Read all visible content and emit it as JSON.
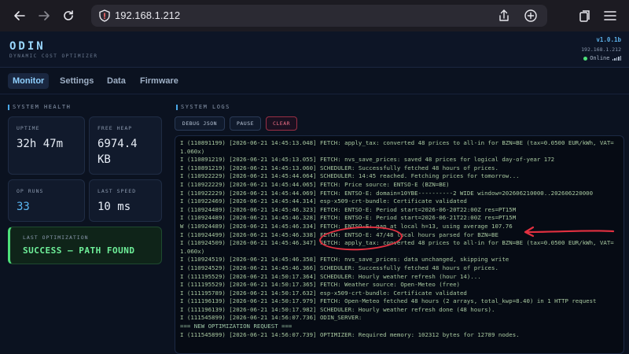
{
  "browser": {
    "url": "192.168.1.212"
  },
  "header": {
    "brand": "ODIN",
    "subtitle": "DYNAMIC COST OPTIMIZER",
    "version": "v1.0.1b",
    "host": "192.168.1.212",
    "status": "Online"
  },
  "tabs": [
    {
      "label": "Monitor"
    },
    {
      "label": "Settings"
    },
    {
      "label": "Data"
    },
    {
      "label": "Firmware"
    }
  ],
  "system_health": {
    "title": "SYSTEM HEALTH",
    "uptime_label": "UPTIME",
    "uptime_value": "32h 47m",
    "heap_label": "FREE HEAP",
    "heap_value": "6974.4 KB",
    "runs_label": "OP RUNS",
    "runs_value": "33",
    "speed_label": "LAST SPEED",
    "speed_value": "10 ms",
    "last_opt_label": "LAST OPTIMIZATION",
    "last_opt_value": "SUCCESS — PATH FOUND"
  },
  "logs": {
    "title": "SYSTEM LOGS",
    "debug_label": "DEBUG JSON",
    "pause_label": "PAUSE",
    "clear_label": "CLEAR",
    "lines": [
      "I (110891199) [2026-06-21 14:45:13.048] FETCH: apply_tax: converted 48 prices to all-in for BZN=BE (tax=0.0500 EUR/kWh, VAT=",
      "1.060x)",
      "I (110891219) [2026-06-21 14:45:13.055] FETCH: nvs_save_prices: saved 48 prices for logical day-of-year 172",
      "I (110891219) [2026-06-21 14:45:13.060] SCHEDULER: Successfully fetched 48 hours of prices.",
      "I (110922229) [2026-06-21 14:45:44.064] SCHEDULER: 14:45 reached. Fetching prices for tomorrow...",
      "I (110922229) [2026-06-21 14:45:44.065] FETCH: Price source: ENTSO-E (BZN=BE)",
      "I (110922229) [2026-06-21 14:45:44.069] FETCH: ENTSO-E: domain=10YBE----------2 WIDE window=202606210000..202606220000",
      "I (110922469) [2026-06-21 14:45:44.314] esp-x509-crt-bundle: Certificate validated",
      "I (110924489) [2026-06-21 14:45:46.323] FETCH: ENTSO-E: Period start=2026-06-20T22:00Z res=PT15M",
      "I (110924489) [2026-06-21 14:45:46.328] FETCH: ENTSO-E: Period start=2026-06-21T22:00Z res=PT15M",
      "W (110924489) [2026-06-21 14:45:46.334] FETCH: ENTSO-E: gap at local h=13, using average 107.76",
      "I (110924499) [2026-06-21 14:45:46.338] FETCH: ENTSO-E: 47/48 local hours parsed for BZN=BE",
      "I (110924509) [2026-06-21 14:45:46.347] FETCH: apply_tax: converted 48 prices to all-in for BZN=BE (tax=0.0500 EUR/kWh, VAT=",
      "1.060x)",
      "I (110924519) [2026-06-21 14:45:46.358] FETCH: nvs_save_prices: data unchanged, skipping write",
      "I (110924529) [2026-06-21 14:45:46.366] SCHEDULER: Successfully fetched 48 hours of prices.",
      "I (111195529) [2026-06-21 14:50:17.364] SCHEDULER: Hourly weather refresh (hour 14)...",
      "I (111195529) [2026-06-21 14:50:17.365] FETCH: Weather source: Open-Meteo (free)",
      "I (111195789) [2026-06-21 14:50:17.632] esp-x509-crt-bundle: Certificate validated",
      "I (111196139) [2026-06-21 14:50:17.979] FETCH: Open-Meteo fetched 48 hours (2 arrays, total_kwp=8.40) in 1 HTTP request",
      "I (111196139) [2026-06-21 14:50:17.982] SCHEDULER: Hourly weather refresh done (48 hours).",
      "I (111545899) [2026-06-21 14:56:07.736] ODIN_SERVER:",
      "=== NEW OPTIMIZATION REQUEST ===",
      "I (111545899) [2026-06-21 14:56:07.739] OPTIMIZER: Required memory: 102312 bytes for 12789 nodes."
    ]
  },
  "colors": {
    "background": "#0b1220",
    "accent": "#4aa8e8",
    "success": "#6ff09a",
    "danger": "#f07088",
    "annotation": "#e23040"
  }
}
